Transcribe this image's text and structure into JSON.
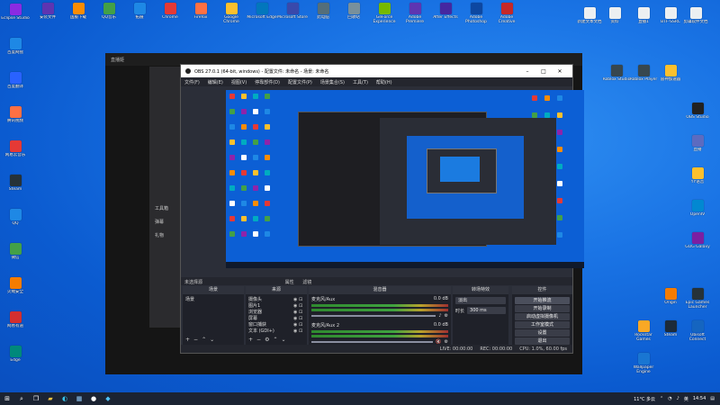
{
  "desktop": {
    "left_icons": [
      {
        "label": "Eclipse Studio",
        "color": "#8a2be2"
      },
      {
        "label": "百度网盘",
        "color": "#1e88e5"
      },
      {
        "label": "百度翻译",
        "color": "#2962ff"
      },
      {
        "label": "腾讯视频",
        "color": "#ff7043"
      },
      {
        "label": "网易云音乐",
        "color": "#e53935"
      },
      {
        "label": "Steam",
        "color": "#263238"
      },
      {
        "label": "QQ",
        "color": "#1e88e5"
      },
      {
        "label": "微信",
        "color": "#43a047"
      },
      {
        "label": "火绒安全",
        "color": "#f57c00"
      },
      {
        "label": "网易有道",
        "color": "#d32f2f"
      },
      {
        "label": "Edge",
        "color": "#00897b"
      }
    ],
    "top_icons": [
      {
        "label": "安装文件",
        "color": "#5e35b1"
      },
      {
        "label": "国服下载",
        "color": "#fb8c00"
      },
      {
        "label": "QQ音乐",
        "color": "#43a047"
      },
      {
        "label": "拓展",
        "color": "#1e88e5"
      },
      {
        "label": "Chrome",
        "color": "#e53935"
      },
      {
        "label": "Firefox",
        "color": "#ff7043"
      },
      {
        "label": "Google Chrome",
        "color": "#fbc02d"
      },
      {
        "label": "Microsoft Edge",
        "color": "#0277bd"
      },
      {
        "label": "Microsoft Store",
        "color": "#3949ab"
      },
      {
        "label": "此电脑",
        "color": "#546e7a"
      },
      {
        "label": "回收站",
        "color": "#78909c"
      },
      {
        "label": "GeForce Experience",
        "color": "#76b900"
      },
      {
        "label": "Adobe Premiere",
        "color": "#5e35b1"
      },
      {
        "label": "After Effects",
        "color": "#4527a0"
      },
      {
        "label": "Adobe Photoshop",
        "color": "#0d47a1"
      },
      {
        "label": "Adobe Creative",
        "color": "#c62828"
      }
    ],
    "right_icons": [
      {
        "label": "新建文本文档",
        "color": "#eceff1"
      },
      {
        "label": "资料",
        "color": "#eceff1"
      },
      {
        "label": "直播1",
        "color": "#eceff1"
      },
      {
        "label": "BTF-SSRC",
        "color": "#eceff1"
      },
      {
        "label": "剪辑软件文档",
        "color": "#eceff1"
      },
      {
        "label": "Roblox Studio",
        "color": "#37474f"
      },
      {
        "label": "Roblox Player",
        "color": "#37474f"
      },
      {
        "label": "雷神加速器",
        "color": "#fbc02d"
      },
      {
        "label": "OBS Studio",
        "color": "#212121"
      },
      {
        "label": "直播",
        "color": "#5c6bc0"
      },
      {
        "label": "YY语音",
        "color": "#fbc02d"
      },
      {
        "label": "OpenIV",
        "color": "#0288d1"
      },
      {
        "label": "GOG Galaxy",
        "color": "#7b1fa2"
      },
      {
        "label": "Origin",
        "color": "#f57c00"
      },
      {
        "label": "Epic Games Launcher",
        "color": "#263238"
      },
      {
        "label": "Rockstar Games",
        "color": "#f9a825"
      },
      {
        "label": "Steam",
        "color": "#1c2b3a"
      },
      {
        "label": "Ubisoft Connect",
        "color": "#1565c0"
      },
      {
        "label": "Wallpaper Engine",
        "color": "#1976d2"
      }
    ]
  },
  "obs": {
    "title": "OBS 27.0.1 (64-bit, windows) - 配置文件: 未命名 - 场景: 未命名",
    "menu": [
      "文件(F)",
      "编辑(E)",
      "视图(V)",
      "停靠部件(D)",
      "配置文件(P)",
      "场景集合(S)",
      "工具(T)",
      "帮助(H)"
    ],
    "dock_bar_text": "未选择源",
    "dock_bar_props": "属性",
    "dock_bar_filters": "滤镜",
    "scenes": {
      "header": "场景",
      "items": [
        "场景"
      ]
    },
    "sources": {
      "header": "来源",
      "items": [
        "摄像头",
        "图片1",
        "浏览器",
        "屏幕",
        "窗口捕获",
        "文本 (GDI+)"
      ]
    },
    "mixer": {
      "header": "混音器",
      "tracks": [
        {
          "name": "麦克风/Aux",
          "db": "0.0 dB"
        },
        {
          "name": "麦克风/Aux 2",
          "db": "0.0 dB"
        }
      ]
    },
    "transitions": {
      "header": "转场特效",
      "type": "淡出",
      "duration_label": "时长",
      "duration": "300 ms"
    },
    "controls": {
      "header": "控件",
      "buttons": [
        "开始推流",
        "开始录制",
        "启动虚拟摄像机",
        "工作室模式",
        "设置",
        "退出"
      ]
    },
    "status": {
      "live": "LIVE: 00:00:00",
      "rec": "REC: 00:00:00",
      "cpu": "CPU: 1.0%, 60.00 fps"
    }
  },
  "background_window": {
    "title": "直播姬",
    "side_items": [
      "开播",
      "工具箱",
      "弹幕",
      "礼物"
    ]
  },
  "taskbar": {
    "weather": "11°C 多云",
    "time": "14:54",
    "lang": "英"
  }
}
